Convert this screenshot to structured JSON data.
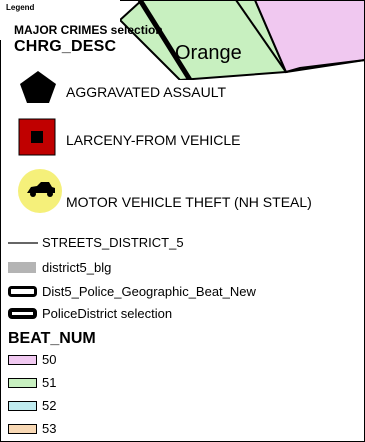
{
  "legend": {
    "title": "Legend",
    "layer_title": "MAJOR CRIMES selection",
    "field_name": "CHRG_DESC",
    "map_label": "Orange",
    "crime_items": [
      {
        "label": "AGGRAVATED ASSAULT",
        "icon": "pentagon-icon",
        "color": "#000000"
      },
      {
        "label": "LARCENY-FROM VEHICLE",
        "icon": "square-icon",
        "color": "#c00000"
      },
      {
        "label": "MOTOR VEHICLE THEFT (NH STEAL)",
        "icon": "car-icon",
        "color": "#f5f07a"
      }
    ],
    "layer_items": [
      {
        "label": "STREETS_DISTRICT_5",
        "icon": "line-icon"
      },
      {
        "label": "district5_blg",
        "icon": "gray-box-icon",
        "color": "#b4b4b4"
      },
      {
        "label": "Dist5_Police_Geographic_Beat_New",
        "icon": "outline-box-icon"
      },
      {
        "label": "PoliceDistrict selection",
        "icon": "black-box-icon"
      }
    ],
    "beat_field": "BEAT_NUM",
    "beats": [
      {
        "label": "50",
        "color": "#f0c8f0"
      },
      {
        "label": "51",
        "color": "#c8f0c0"
      },
      {
        "label": "52",
        "color": "#c0ecf0"
      },
      {
        "label": "53",
        "color": "#f8d8b4"
      }
    ]
  }
}
